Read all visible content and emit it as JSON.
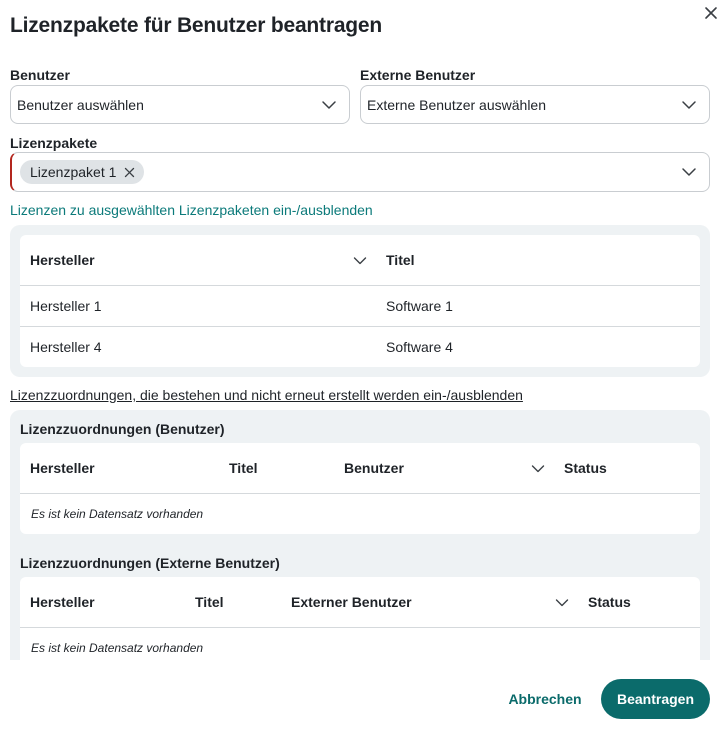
{
  "dialog": {
    "title": "Lizenzpakete für Benutzer beantragen"
  },
  "fields": {
    "benutzer": {
      "label": "Benutzer",
      "placeholder": "Benutzer auswählen"
    },
    "externe_benutzer": {
      "label": "Externe Benutzer",
      "placeholder": "Externe Benutzer auswählen"
    },
    "lizenzpakete": {
      "label": "Lizenzpakete",
      "chips": [
        "Lizenzpaket 1"
      ]
    }
  },
  "licenses": {
    "toggle_link": "Lizenzen zu ausgewählten Lizenzpaketen ein-/ausblenden",
    "columns": [
      "Hersteller",
      "Titel"
    ],
    "rows": [
      [
        "Hersteller 1",
        "Software 1"
      ],
      [
        "Hersteller 4",
        "Software 4"
      ]
    ]
  },
  "assignments": {
    "toggle_link": "Lizenzzuordnungen, die bestehen und nicht erneut erstellt werden ein-/ausblenden",
    "users": {
      "title": "Lizenzzuordnungen (Benutzer)",
      "columns": [
        "Hersteller",
        "Titel",
        "Benutzer",
        "Status"
      ],
      "empty": "Es ist kein Datensatz vorhanden"
    },
    "external_users": {
      "title": "Lizenzzuordnungen (Externe Benutzer)",
      "columns": [
        "Hersteller",
        "Titel",
        "Externer Benutzer",
        "Status"
      ],
      "empty": "Es ist kein Datensatz vorhanden"
    }
  },
  "actions": {
    "cancel": "Abbrechen",
    "submit": "Beantragen"
  },
  "icons": {
    "close": "close-icon",
    "dropdown": "chevron-down-icon",
    "chip_remove": "close-icon",
    "sort": "chevron-down-icon"
  },
  "colors": {
    "accent": "#0b6b6b",
    "link": "#0b7a7a",
    "panel": "#eef2f4",
    "invalid": "#b3261e"
  }
}
